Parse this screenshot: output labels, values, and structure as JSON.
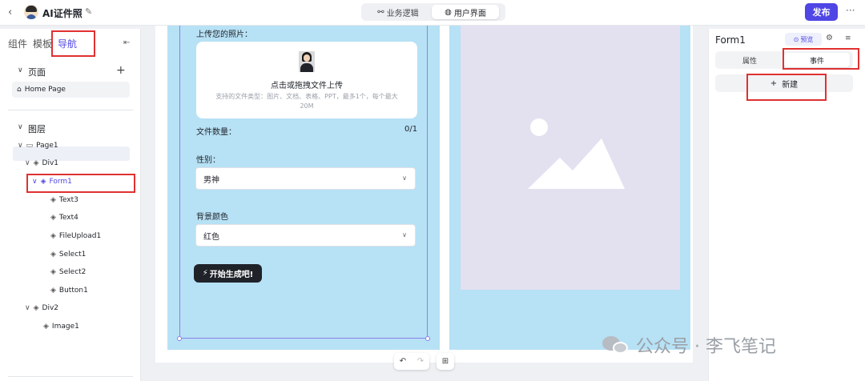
{
  "topbar": {
    "back_icon": "chevron-left-icon",
    "app_title": "AI证件照",
    "segment_tabs": [
      "业务逻辑",
      "用户界面"
    ],
    "active_segment": "用户界面",
    "publish_label": "发布"
  },
  "left_panel": {
    "tabs": [
      "组件",
      "模板",
      "导航"
    ],
    "active_tab": "导航",
    "pages_section": "页面",
    "pages": [
      "Home Page"
    ],
    "layers_section": "图层",
    "tree": [
      {
        "label": "Page1",
        "depth": 0,
        "icon": "page-icon"
      },
      {
        "label": "Div1",
        "depth": 1,
        "icon": "layer-icon"
      },
      {
        "label": "Form1",
        "depth": 2,
        "icon": "layer-icon",
        "selected": true
      },
      {
        "label": "Text3",
        "depth": 3,
        "icon": "layer-icon"
      },
      {
        "label": "Text4",
        "depth": 3,
        "icon": "layer-icon"
      },
      {
        "label": "FileUpload1",
        "depth": 3,
        "icon": "layer-icon"
      },
      {
        "label": "Select1",
        "depth": 3,
        "icon": "layer-icon"
      },
      {
        "label": "Select2",
        "depth": 3,
        "icon": "layer-icon"
      },
      {
        "label": "Button1",
        "depth": 3,
        "icon": "layer-icon"
      },
      {
        "label": "Div2",
        "depth": 1,
        "icon": "layer-icon"
      },
      {
        "label": "Image1",
        "depth": 2,
        "icon": "layer-icon"
      }
    ]
  },
  "form": {
    "upload_label": "上传您的照片：",
    "upload_main": "点击或拖拽文件上传",
    "upload_hint": "支持的文件类型：图片、文档、表格、PPT，最多1个，每个最大 20M",
    "count_label": "文件数量：",
    "count_value": "0/1",
    "gender_label": "性别：",
    "gender_value": "男神",
    "bg_label": "背景颜色",
    "bg_value": "红色",
    "generate_label": "开始生成吧!"
  },
  "right_panel": {
    "title": "Form1",
    "preview_label": "预览",
    "tabs": [
      "属性",
      "事件"
    ],
    "active_tab": "事件",
    "new_label": "新建"
  },
  "watermark": {
    "text": "公众号 · 李飞笔记"
  },
  "colors": {
    "accent": "#4f46e5",
    "canvas_phone": "#b7e1f5",
    "highlight_red": "#e03131"
  }
}
